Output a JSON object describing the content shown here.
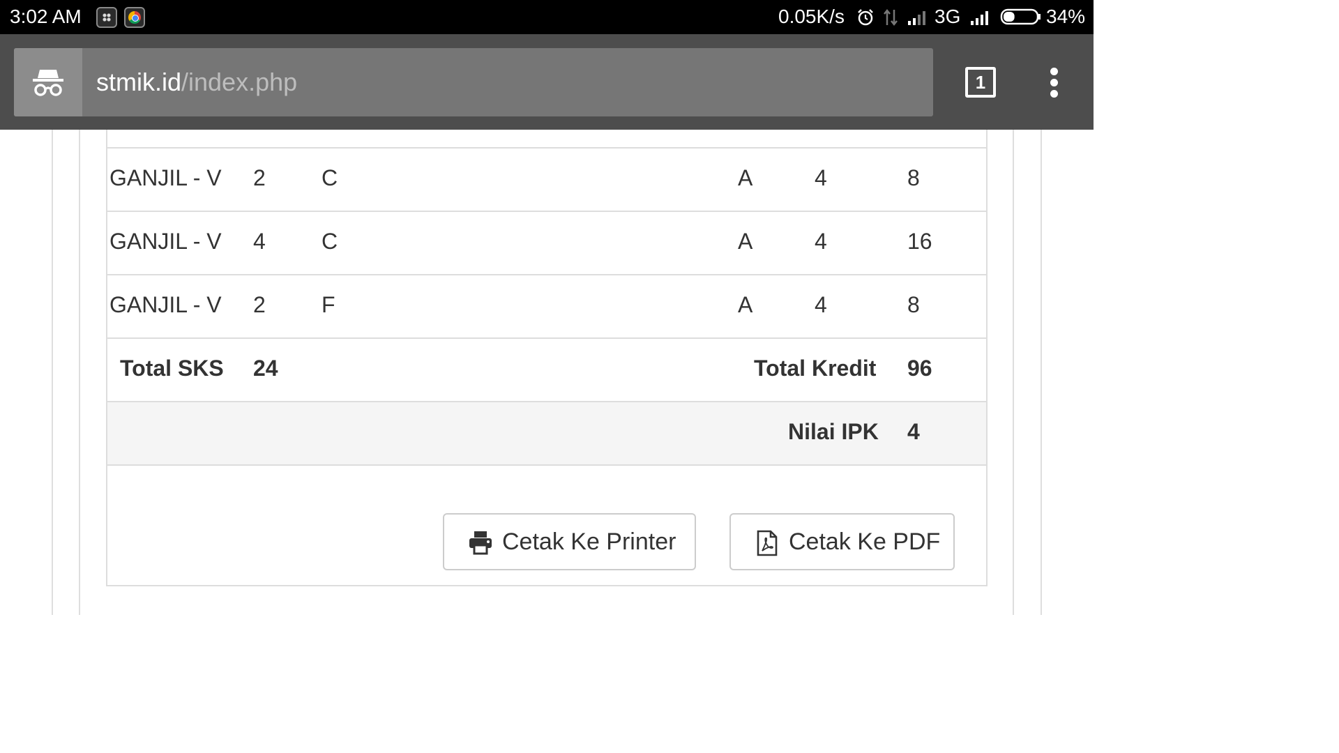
{
  "status_bar": {
    "time": "3:02 AM",
    "net_speed": "0.05K/s",
    "network": "3G",
    "battery": "34%",
    "battery_level": 0.34,
    "icons": [
      "bbm-icon",
      "chrome-icon",
      "alarm-icon",
      "data-transfer-icon",
      "signal-icon",
      "signal-icon",
      "battery-icon"
    ]
  },
  "browser": {
    "url_host": "stmik.id",
    "url_path": "/index.php",
    "tab_count": "1"
  },
  "table": {
    "rows": [
      {
        "semester": "GANJIL - V",
        "sks": "2",
        "grade": "C",
        "nilai": "A",
        "bobot": "4",
        "kredit": "8"
      },
      {
        "semester": "GANJIL - V",
        "sks": "4",
        "grade": "C",
        "nilai": "A",
        "bobot": "4",
        "kredit": "16"
      },
      {
        "semester": "GANJIL - V",
        "sks": "2",
        "grade": "F",
        "nilai": "A",
        "bobot": "4",
        "kredit": "8"
      }
    ],
    "total_sks_label": "Total SKS",
    "total_sks_value": "24",
    "total_kredit_label": "Total Kredit",
    "total_kredit_value": "96",
    "ipk_label": "Nilai IPK",
    "ipk_value": "4"
  },
  "actions": {
    "print_label": "Cetak Ke Printer",
    "pdf_label": "Cetak Ke PDF"
  }
}
